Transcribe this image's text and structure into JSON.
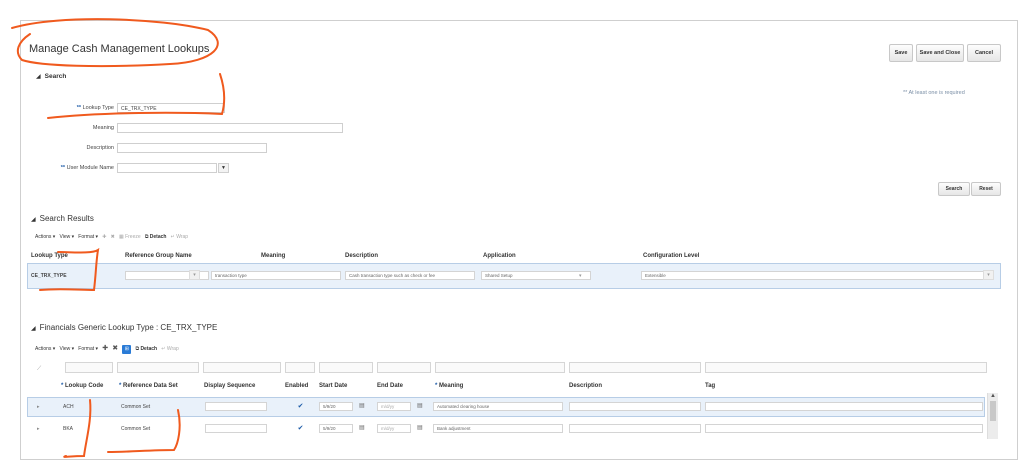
{
  "page": {
    "title": "Manage Cash Management Lookups"
  },
  "toolbar": {
    "save": "Save",
    "save_close": "Save and Close",
    "cancel": "Cancel"
  },
  "search": {
    "heading": "Search",
    "required_marker": "**",
    "hint": "** At least one is required",
    "lookup_type_label": "Lookup Type",
    "lookup_type_value": "CE_TRX_TYPE",
    "meaning_label": "Meaning",
    "description_label": "Description",
    "user_module_label": "User Module Name",
    "search_button": "Search",
    "reset_button": "Reset"
  },
  "results": {
    "heading": "Search Results",
    "toolbar": {
      "actions": "Actions ▾",
      "view": "View ▾",
      "format": "Format ▾",
      "freeze": "Freeze",
      "detach": "Detach",
      "wrap": "Wrap"
    },
    "columns": [
      "Lookup Type",
      "Reference Group Name",
      "Meaning",
      "Description",
      "Application",
      "Configuration Level"
    ],
    "row": {
      "lookup_type": "CE_TRX_TYPE",
      "meaning": "transaction type",
      "description": "Cash transaction type such as check or fee",
      "application": "Shared Setup",
      "config_level": "Extensible"
    }
  },
  "generic": {
    "heading": "Financials Generic Lookup Type : CE_TRX_TYPE",
    "toolbar": {
      "actions": "Actions ▾",
      "view": "View ▾",
      "format": "Format ▾",
      "detach": "Detach",
      "wrap": "Wrap"
    },
    "columns": {
      "lookup_code": "Lookup Code",
      "ref_data_set": "Reference Data Set",
      "display_seq": "Display Sequence",
      "enabled": "Enabled",
      "start_date": "Start Date",
      "end_date": "End Date",
      "meaning": "Meaning",
      "description": "Description",
      "tag": "Tag"
    },
    "required_marker": "*",
    "rows": [
      {
        "code": "ACH",
        "ref_set": "Common Set",
        "start": "5/9/20",
        "end": "m/d/yy",
        "meaning": "Automated clearing house"
      },
      {
        "code": "BKA",
        "ref_set": "Common Set",
        "start": "5/9/20",
        "end": "m/d/yy",
        "meaning": "Bank adjustment"
      }
    ]
  },
  "colors": {
    "accent": "#1c5ba8",
    "annotation": "#f05a1e",
    "row_highlight": "#e9f1fa"
  }
}
